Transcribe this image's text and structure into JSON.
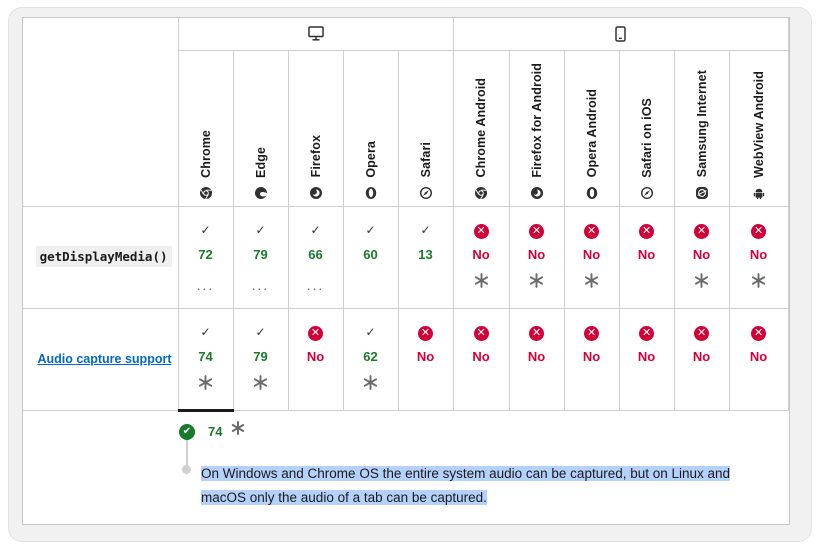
{
  "platforms": {
    "desktop_icon": "monitor-icon",
    "mobile_icon": "smartphone-icon"
  },
  "browsers": [
    {
      "name": "Chrome",
      "icon": "chrome-icon"
    },
    {
      "name": "Edge",
      "icon": "edge-icon"
    },
    {
      "name": "Firefox",
      "icon": "firefox-icon"
    },
    {
      "name": "Opera",
      "icon": "opera-icon"
    },
    {
      "name": "Safari",
      "icon": "safari-icon"
    },
    {
      "name": "Chrome Android",
      "icon": "chrome-icon"
    },
    {
      "name": "Firefox for Android",
      "icon": "firefox-icon"
    },
    {
      "name": "Opera Android",
      "icon": "opera-icon"
    },
    {
      "name": "Safari on iOS",
      "icon": "safari-icon"
    },
    {
      "name": "Samsung Internet",
      "icon": "samsung-internet-icon"
    },
    {
      "name": "WebView Android",
      "icon": "android-icon"
    }
  ],
  "rows": [
    {
      "feature": "getDisplayMedia()",
      "feature_style": "code",
      "cells": [
        {
          "support": "yes",
          "version": "72",
          "extra": "..."
        },
        {
          "support": "yes",
          "version": "79",
          "extra": "..."
        },
        {
          "support": "yes",
          "version": "66",
          "extra": "..."
        },
        {
          "support": "yes",
          "version": "60",
          "extra": ""
        },
        {
          "support": "yes",
          "version": "13",
          "extra": ""
        },
        {
          "support": "no",
          "version": "No",
          "extra": "*"
        },
        {
          "support": "no",
          "version": "No",
          "extra": "*"
        },
        {
          "support": "no",
          "version": "No",
          "extra": "*"
        },
        {
          "support": "no",
          "version": "No",
          "extra": ""
        },
        {
          "support": "no",
          "version": "No",
          "extra": "*"
        },
        {
          "support": "no",
          "version": "No",
          "extra": "*"
        }
      ]
    },
    {
      "feature": "Audio capture support",
      "feature_style": "link",
      "cells": [
        {
          "support": "yes",
          "version": "74",
          "extra": "*"
        },
        {
          "support": "yes",
          "version": "79",
          "extra": "*"
        },
        {
          "support": "no",
          "version": "No",
          "extra": ""
        },
        {
          "support": "yes",
          "version": "62",
          "extra": "*"
        },
        {
          "support": "no",
          "version": "No",
          "extra": ""
        },
        {
          "support": "no",
          "version": "No",
          "extra": ""
        },
        {
          "support": "no",
          "version": "No",
          "extra": ""
        },
        {
          "support": "no",
          "version": "No",
          "extra": ""
        },
        {
          "support": "no",
          "version": "No",
          "extra": ""
        },
        {
          "support": "no",
          "version": "No",
          "extra": ""
        },
        {
          "support": "no",
          "version": "No",
          "extra": ""
        }
      ]
    }
  ],
  "note": {
    "version": "74",
    "text": "On Windows and Chrome OS the entire system audio can be captured, but on Linux and macOS only the audio of a tab can be captured."
  },
  "colors": {
    "supported": "#1a7a2c",
    "unsupported": "#d30038",
    "link": "#0069c2",
    "selection": "#b4d1fb"
  }
}
